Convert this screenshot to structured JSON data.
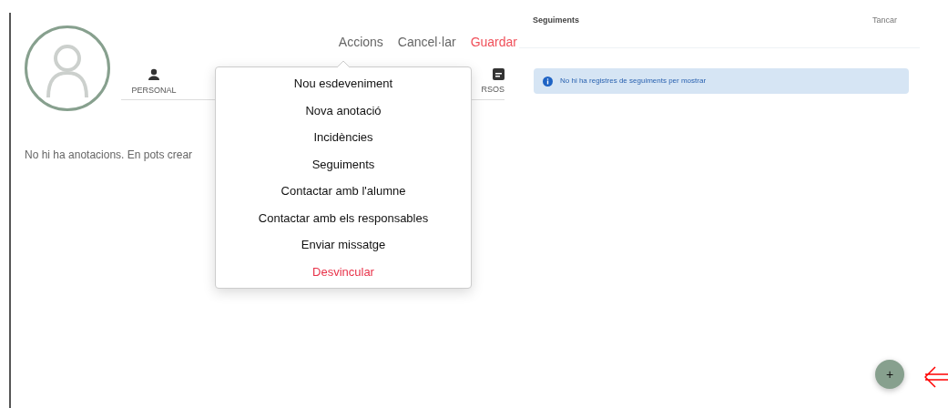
{
  "header_actions": [
    {
      "label": "Accions",
      "kind": "plain"
    },
    {
      "label": "Cancel·lar",
      "kind": "plain"
    },
    {
      "label": "Guardar",
      "kind": "primary"
    }
  ],
  "tabs": [
    {
      "label": "PERSONAL",
      "kind": "person",
      "selected": false
    },
    {
      "label": "RSOS",
      "kind": "card",
      "selected": false
    }
  ],
  "empty_message": "No hi ha anotacions. En pots crear",
  "actions_menu": [
    {
      "label": "Nou esdeveniment",
      "kind": "normal"
    },
    {
      "label": "Nova anotació",
      "kind": "normal"
    },
    {
      "label": "Incidències",
      "kind": "normal"
    },
    {
      "label": "Seguiments",
      "kind": "normal"
    },
    {
      "label": "Contactar amb l'alumne",
      "kind": "normal"
    },
    {
      "label": "Contactar amb els responsables",
      "kind": "normal"
    },
    {
      "label": "Enviar missatge",
      "kind": "normal"
    },
    {
      "label": "Desvincular",
      "kind": "danger"
    }
  ],
  "side_panel": {
    "title": "Seguiments",
    "close": "Tancar",
    "info": "No hi ha registres de seguiments per mostrar"
  },
  "fab": {
    "label": "+"
  }
}
